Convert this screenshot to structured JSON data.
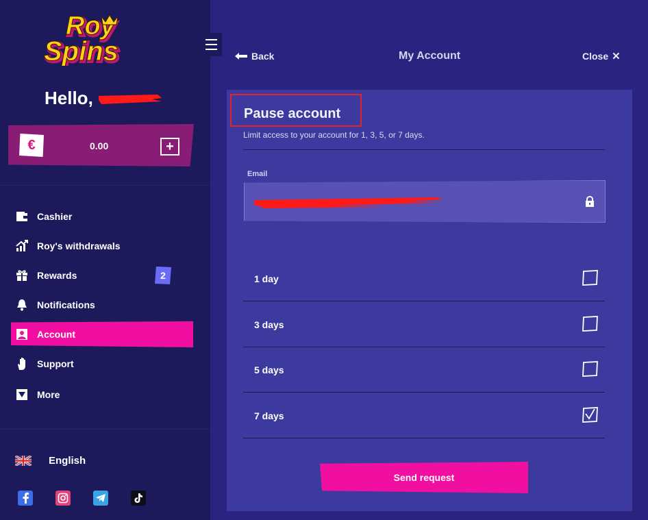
{
  "app": {
    "brand": "Roy Spins"
  },
  "header": {
    "back_label": "Back",
    "title": "My Account",
    "close_label": "Close"
  },
  "sidebar": {
    "greeting": "Hello,",
    "balance": "0.00",
    "currency_icon": "euro-icon",
    "menu": [
      {
        "label": "Cashier",
        "icon": "wallet-icon"
      },
      {
        "label": "Roy's withdrawals",
        "icon": "chart-up-icon"
      },
      {
        "label": "Rewards",
        "icon": "gift-icon",
        "badge": "2"
      },
      {
        "label": "Notifications",
        "icon": "bell-icon"
      },
      {
        "label": "Account",
        "icon": "user-icon",
        "active": true
      },
      {
        "label": "Support",
        "icon": "hand-icon"
      },
      {
        "label": "More",
        "icon": "triangle-down-icon"
      }
    ],
    "language": "English",
    "socials": [
      "facebook-icon",
      "instagram-icon",
      "telegram-icon",
      "tiktok-icon"
    ]
  },
  "pause": {
    "title": "Pause account",
    "description": "Limit access to your account for 1, 3, 5, or 7 days.",
    "email_label": "Email",
    "options": [
      {
        "label": "1 day",
        "checked": false
      },
      {
        "label": "3 days",
        "checked": false
      },
      {
        "label": "5 days",
        "checked": false
      },
      {
        "label": "7 days",
        "checked": true
      }
    ],
    "submit_label": "Send request"
  },
  "colors": {
    "sidebar_bg": "#1d1a5c",
    "page_bg": "#2a2380",
    "card_bg": "#3c3a9e",
    "accent_pink": "#f00fa0",
    "balance_bg": "#891c74",
    "highlight_red": "#e1232d",
    "badge_purple": "#6a6cf5"
  }
}
